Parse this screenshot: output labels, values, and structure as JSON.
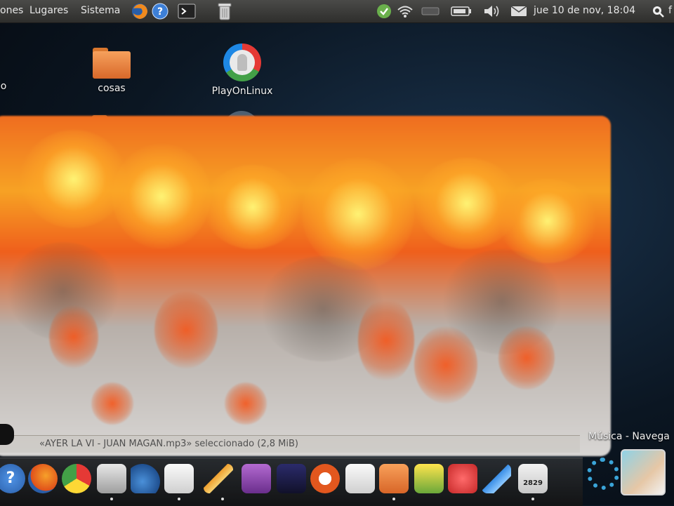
{
  "top_panel": {
    "menus": [
      "ones",
      "Lugares",
      "Sistema"
    ],
    "clock": "jue 10 de nov, 18:04",
    "search_cut": "f"
  },
  "desktop": {
    "icons": [
      {
        "label": "o"
      },
      {
        "label": "cosas"
      },
      {
        "label": "PlayOnLinux"
      }
    ]
  },
  "file_manager": {
    "status_text": "«AYER LA VI - JUAN MAGAN.mp3» seleccionado (2,8 MiB)"
  },
  "side_window": {
    "title": "Música - Navega"
  },
  "dock": {
    "calendar_number": "2829"
  },
  "colors": {
    "panel": "#3a3a38",
    "fire_orange": "#ef6d20",
    "fire_yellow": "#f7e04a",
    "desktop_blue": "#1b3550"
  }
}
